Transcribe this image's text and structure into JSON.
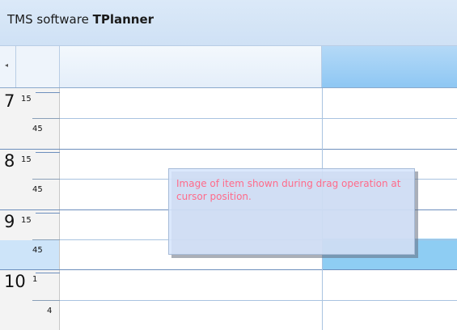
{
  "window": {
    "title_prefix": "TMS software ",
    "title_brand": "TPlanner"
  },
  "header": {
    "prev_arrow": "◂"
  },
  "ruler": {
    "hours": [
      {
        "hour": "7",
        "minutes_top": "15",
        "minutes_bottom": "45"
      },
      {
        "hour": "8",
        "minutes_top": "15",
        "minutes_bottom": "45"
      },
      {
        "hour": "9",
        "minutes_top": "15",
        "minutes_bottom": "45"
      },
      {
        "hour": "10",
        "minutes_top": "1",
        "minutes_bottom": "4"
      }
    ]
  },
  "drag_item": {
    "text": "Image of item shown during drag operation at cursor position."
  },
  "colors": {
    "caption_bg": "#d4e4f6",
    "selected_cell": "#8ecdf3",
    "selected_header": "#a3d1f5",
    "drag_text": "#ff6b8a"
  },
  "icons": {
    "prev_arrow": "chevron-left-icon"
  }
}
